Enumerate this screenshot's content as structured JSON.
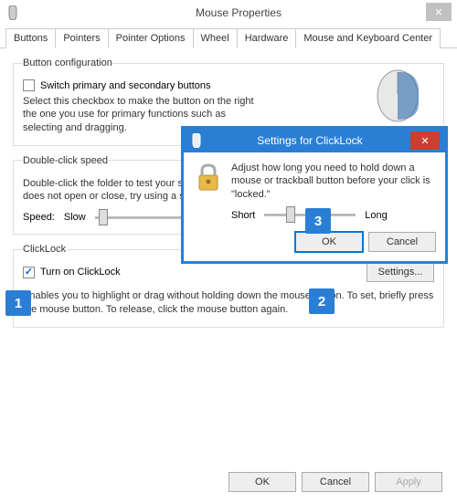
{
  "window": {
    "title": "Mouse Properties"
  },
  "tabs": [
    "Buttons",
    "Pointers",
    "Pointer Options",
    "Wheel",
    "Hardware",
    "Mouse and Keyboard Center"
  ],
  "buttonConfig": {
    "legend": "Button configuration",
    "checkbox_label": "Switch primary and secondary buttons",
    "desc": "Select this checkbox to make the button on the right the one you use for primary functions such as selecting and dragging."
  },
  "doubleClick": {
    "legend": "Double-click speed",
    "desc": "Double-click the folder to test your setting. If the folder does not open or close, try using a slower setting.",
    "speed_label": "Speed:",
    "slow": "Slow"
  },
  "clickLock": {
    "legend": "ClickLock",
    "checkbox_label": "Turn on ClickLock",
    "settings_btn": "Settings...",
    "desc": "Enables you to highlight or drag without holding down the mouse button. To set, briefly press the mouse button. To release, click the mouse button again."
  },
  "buttons": {
    "ok": "OK",
    "cancel": "Cancel",
    "apply": "Apply"
  },
  "modal": {
    "title": "Settings for ClickLock",
    "text": "Adjust how long you need to hold down a mouse or trackball button before your click is \"locked.\"",
    "short": "Short",
    "long": "Long",
    "ok": "OK",
    "cancel": "Cancel"
  },
  "callouts": {
    "c1": "1",
    "c2": "2",
    "c3": "3"
  }
}
